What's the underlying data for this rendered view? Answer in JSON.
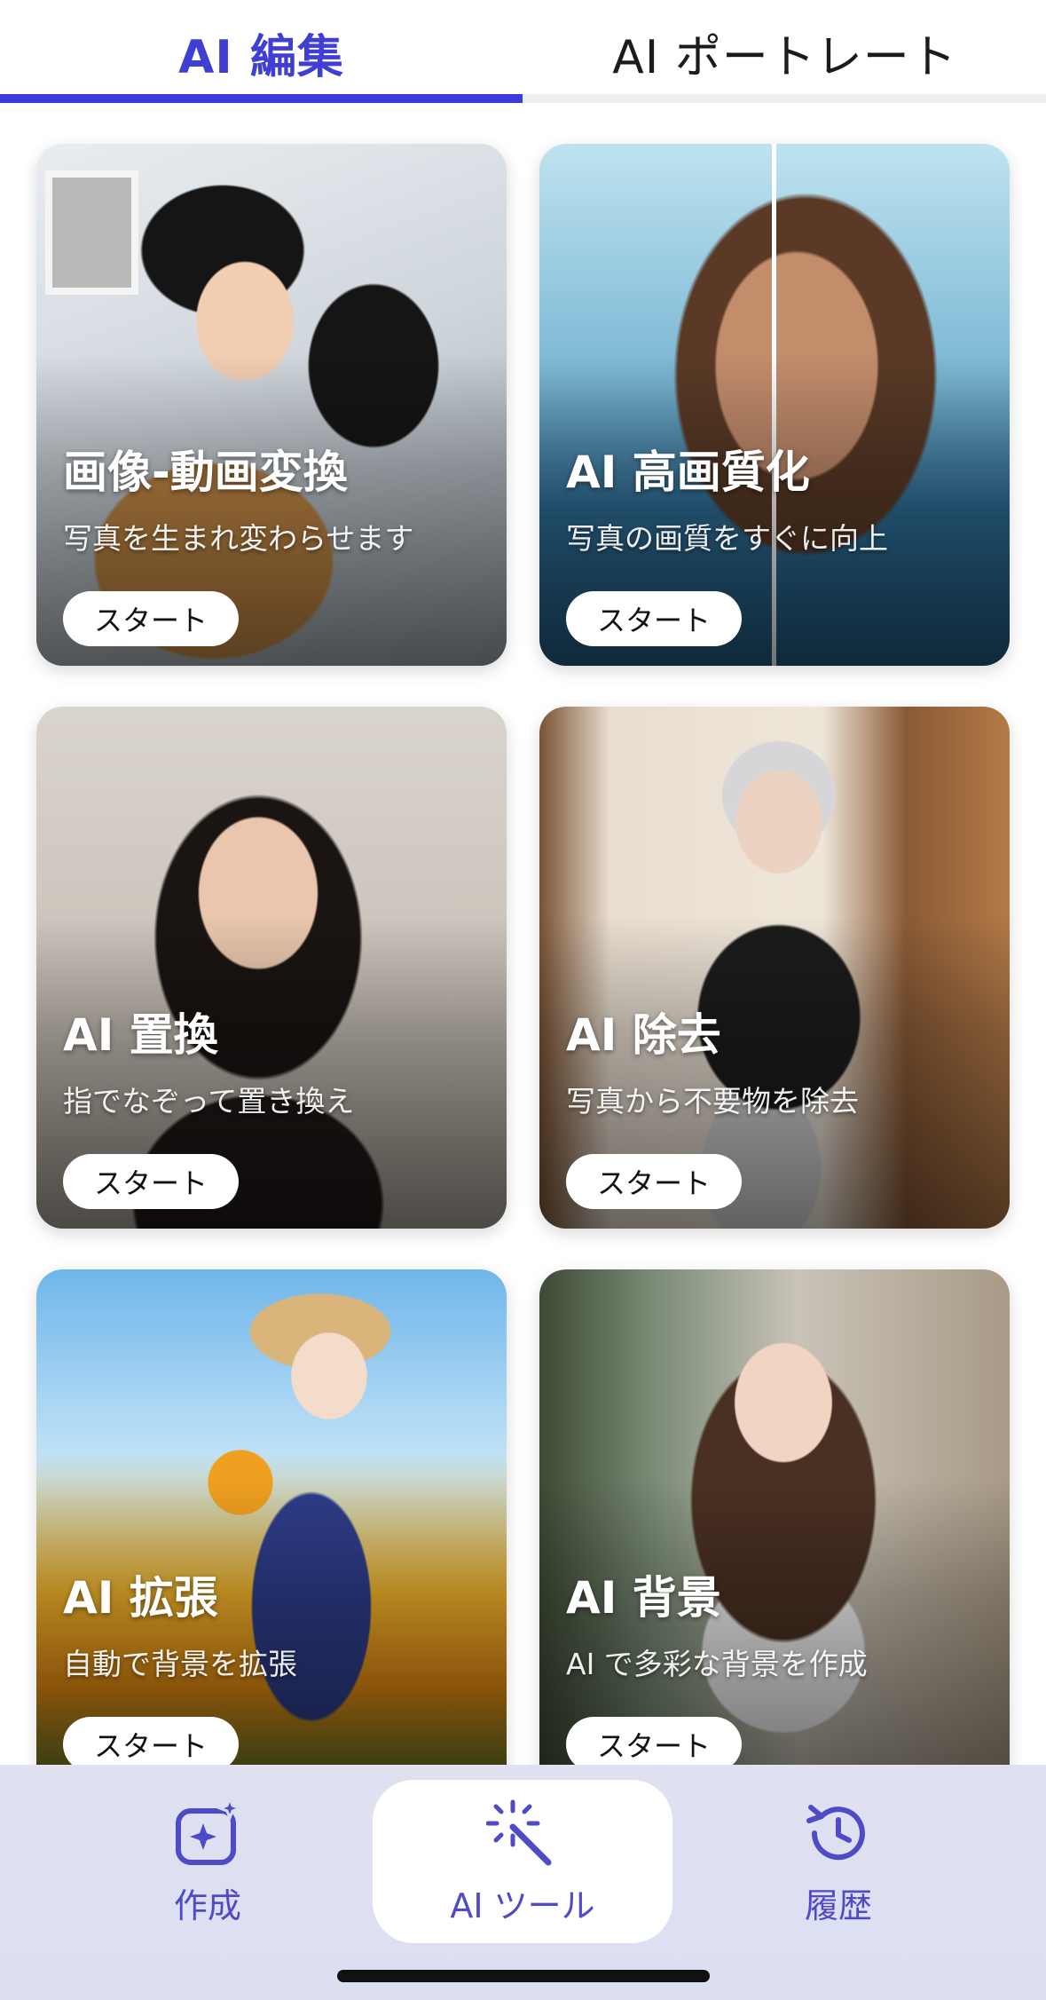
{
  "tabs": [
    {
      "label": "AI 編集",
      "active": true
    },
    {
      "label": "AI ポートレート",
      "active": false
    }
  ],
  "colors": {
    "accent": "#3a3add",
    "nav_label": "#4e4ac8",
    "nav_background": "#dcdff2"
  },
  "cards": [
    {
      "title": "画像-動画変換",
      "subtitle": "写真を生まれ変わらせます",
      "button": "スタート"
    },
    {
      "title": "AI 高画質化",
      "subtitle": "写真の画質をすぐに向上",
      "button": "スタート"
    },
    {
      "title": "AI 置換",
      "subtitle": "指でなぞって置き換え",
      "button": "スタート"
    },
    {
      "title": "AI 除去",
      "subtitle": "写真から不要物を除去",
      "button": "スタート"
    },
    {
      "title": "AI 拡張",
      "subtitle": "自動で背景を拡張",
      "button": "スタート"
    },
    {
      "title": "AI 背景",
      "subtitle": "AI で多彩な背景を作成",
      "button": "スタート"
    }
  ],
  "bottom_nav": {
    "items": [
      {
        "label": "作成",
        "icon": "sparkle-image-icon",
        "active": false
      },
      {
        "label": "AI ツール",
        "icon": "magic-wand-icon",
        "active": true
      },
      {
        "label": "履歴",
        "icon": "history-clock-icon",
        "active": false
      }
    ]
  }
}
